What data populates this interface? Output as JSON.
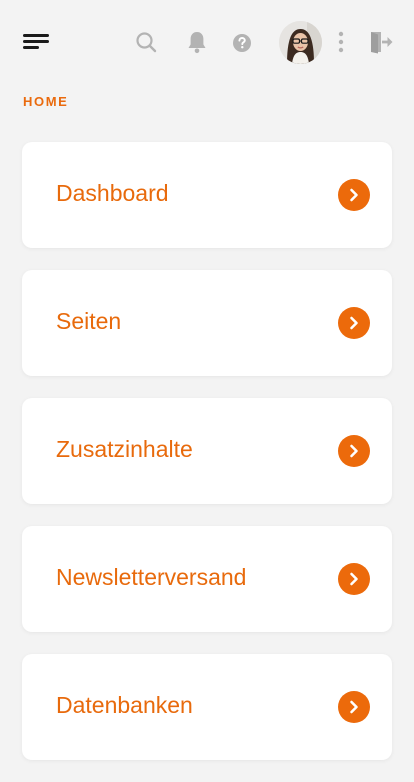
{
  "header": {
    "icons": {
      "menu": "hamburger-menu-icon",
      "search": "search-icon",
      "notifications": "bell-icon",
      "help": "help-icon",
      "avatar": "user-avatar",
      "more": "vertical-dots-icon",
      "logout": "logout-icon"
    }
  },
  "breadcrumb": {
    "label": "HOME"
  },
  "menu": {
    "items": [
      {
        "label": "Dashboard"
      },
      {
        "label": "Seiten"
      },
      {
        "label": "Zusatzinhalte"
      },
      {
        "label": "Newsletterversand"
      },
      {
        "label": "Datenbanken"
      }
    ]
  },
  "colors": {
    "accent": "#ea6a0d",
    "background": "#f3f3f3",
    "card": "#ffffff",
    "icon_gray": "#b3b3b3"
  }
}
